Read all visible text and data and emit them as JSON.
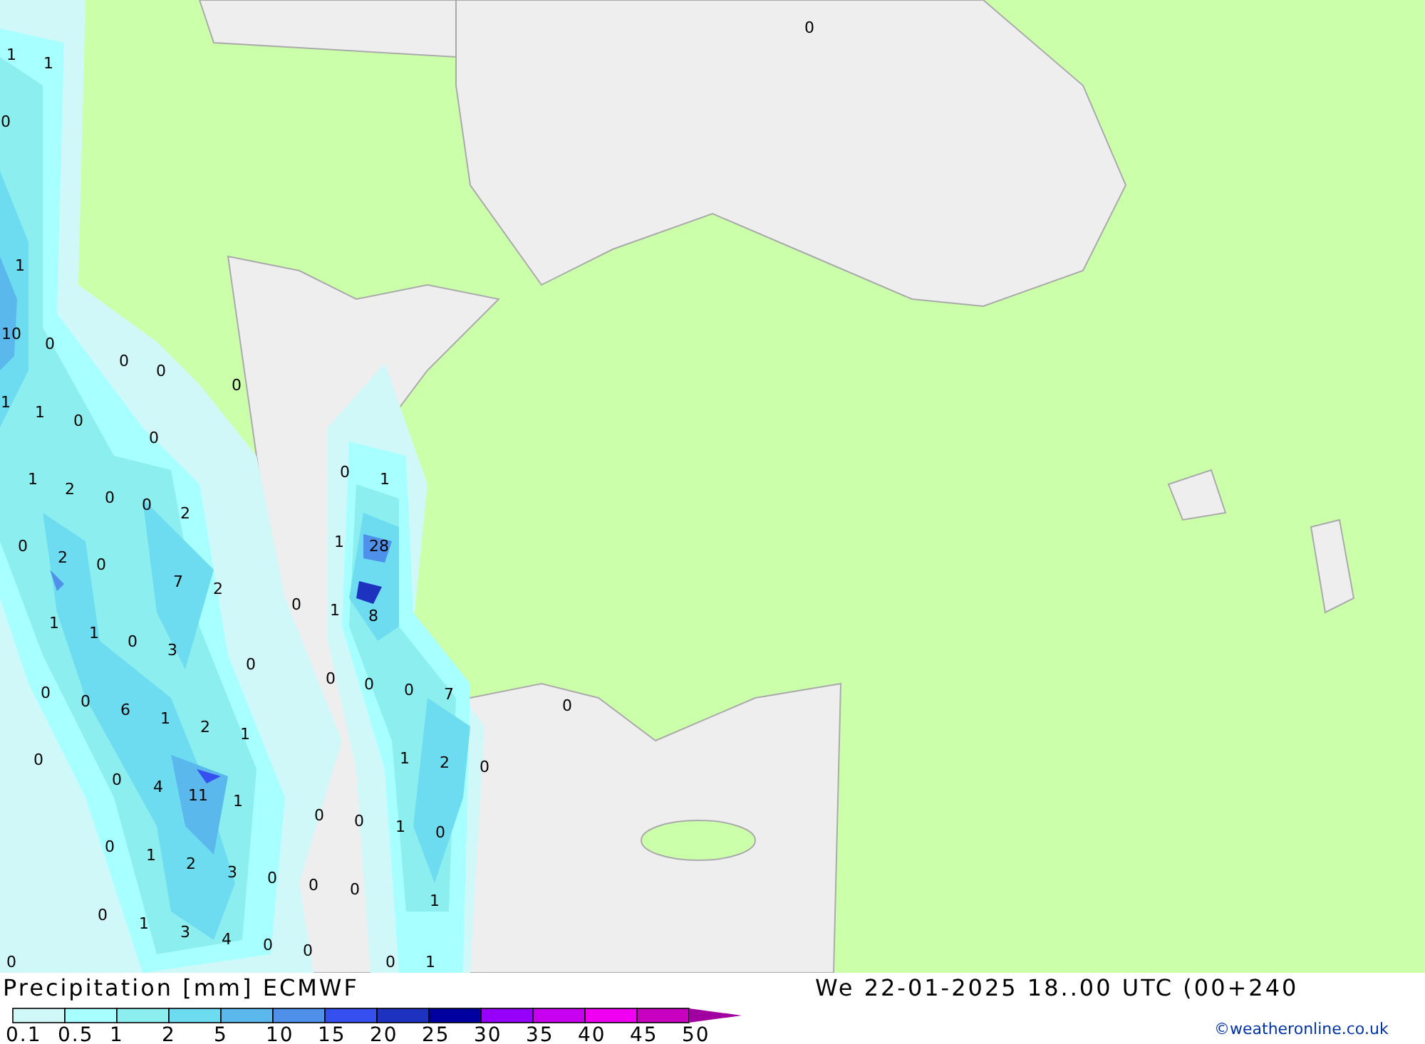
{
  "map": {
    "labels": [
      {
        "text": "0"
      },
      {
        "text": "1"
      },
      {
        "text": "1"
      },
      {
        "text": "0"
      },
      {
        "text": "1"
      },
      {
        "text": "10"
      },
      {
        "text": "0"
      },
      {
        "text": "0"
      },
      {
        "text": "0"
      },
      {
        "text": "0"
      },
      {
        "text": "1"
      },
      {
        "text": "1"
      },
      {
        "text": "0"
      },
      {
        "text": "0"
      },
      {
        "text": "1"
      },
      {
        "text": "2"
      },
      {
        "text": "0"
      },
      {
        "text": "0"
      },
      {
        "text": "2"
      },
      {
        "text": "0"
      },
      {
        "text": "2"
      },
      {
        "text": "0"
      },
      {
        "text": "7"
      },
      {
        "text": "2"
      },
      {
        "text": "1"
      },
      {
        "text": "1"
      },
      {
        "text": "0"
      },
      {
        "text": "3"
      },
      {
        "text": "0"
      },
      {
        "text": "0"
      },
      {
        "text": "0"
      },
      {
        "text": "6"
      },
      {
        "text": "1"
      },
      {
        "text": "2"
      },
      {
        "text": "1"
      },
      {
        "text": "0"
      },
      {
        "text": "0"
      },
      {
        "text": "4"
      },
      {
        "text": "11"
      },
      {
        "text": "1"
      },
      {
        "text": "0"
      },
      {
        "text": "1"
      },
      {
        "text": "2"
      },
      {
        "text": "3"
      },
      {
        "text": "0"
      },
      {
        "text": "0"
      },
      {
        "text": "1"
      },
      {
        "text": "3"
      },
      {
        "text": "4"
      },
      {
        "text": "0"
      },
      {
        "text": "0"
      },
      {
        "text": "0"
      },
      {
        "text": "1"
      },
      {
        "text": "1"
      },
      {
        "text": "28"
      },
      {
        "text": "0"
      },
      {
        "text": "1"
      },
      {
        "text": "8"
      },
      {
        "text": "0"
      },
      {
        "text": "0"
      },
      {
        "text": "0"
      },
      {
        "text": "7"
      },
      {
        "text": "0"
      },
      {
        "text": "1"
      },
      {
        "text": "2"
      },
      {
        "text": "0"
      },
      {
        "text": "0"
      },
      {
        "text": "0"
      },
      {
        "text": "1"
      },
      {
        "text": "0"
      },
      {
        "text": "0"
      },
      {
        "text": "0"
      },
      {
        "text": "1"
      },
      {
        "text": "0"
      },
      {
        "text": "0"
      },
      {
        "text": "1"
      }
    ]
  },
  "legend": {
    "title": "Precipitation [mm] ECMWF",
    "segments": [
      {
        "kind": "box",
        "color": "#d0f8f8"
      },
      {
        "kind": "box",
        "color": "#a8ffff"
      },
      {
        "kind": "box",
        "color": "#8ceeee"
      },
      {
        "kind": "box",
        "color": "#6edcf0"
      },
      {
        "kind": "box",
        "color": "#5ab8ec"
      },
      {
        "kind": "box",
        "color": "#4e90ea"
      },
      {
        "kind": "box",
        "color": "#3650f0"
      },
      {
        "kind": "box",
        "color": "#1e32c0"
      },
      {
        "kind": "box",
        "color": "#0000a0"
      },
      {
        "kind": "box",
        "color": "#9600fa"
      },
      {
        "kind": "box",
        "color": "#c800f0"
      },
      {
        "kind": "box",
        "color": "#f000f0"
      },
      {
        "kind": "box",
        "color": "#c800c0"
      },
      {
        "kind": "arrow",
        "color": "#a000a0"
      }
    ],
    "ticks": [
      "0.1",
      "0.5",
      "1",
      "2",
      "5",
      "10",
      "15",
      "20",
      "25",
      "30",
      "35",
      "40",
      "45",
      "50"
    ]
  },
  "valid_time": "We 22-01-2025 18..00 UTC (00+240",
  "credit": "©weatheronline.co.uk"
}
